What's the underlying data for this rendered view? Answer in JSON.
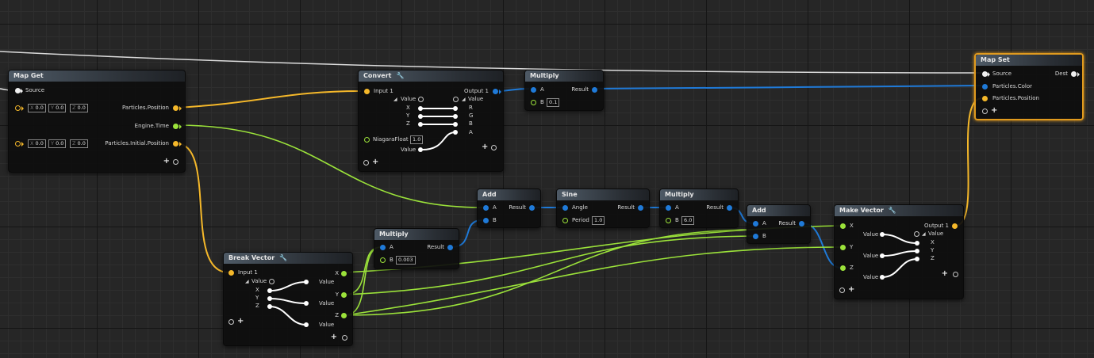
{
  "colors": {
    "position": "#f5b82a",
    "float": "#9be23a",
    "color": "#1f7ad8",
    "exec": "#f0f0f0",
    "selected": "#e09a1e"
  },
  "map_get": {
    "title": "Map Get",
    "source": "Source",
    "pos_out": "Particles.Position",
    "time_out": "Engine.Time",
    "init_out": "Particles.Initial.Position",
    "x_label": "X",
    "y_label": "Y",
    "z_label": "Z",
    "vec1": [
      "0.0",
      "0.0",
      "0.0"
    ],
    "vec2": [
      "0.0",
      "0.0",
      "0.0"
    ]
  },
  "convert": {
    "title": "Convert",
    "input": "Input 1",
    "output": "Output 1",
    "value_l": "Value",
    "value_r": "Value",
    "x": "X",
    "y": "Y",
    "z": "Z",
    "r": "R",
    "g": "G",
    "b": "B",
    "a": "A",
    "nf_label": "NiagaraFloat",
    "nf_value": "1.0",
    "value_bottom": "Value"
  },
  "multiply1": {
    "title": "Multiply",
    "a": "A",
    "b": "B",
    "result": "Result",
    "b_value": "0.1"
  },
  "map_set": {
    "title": "Map Set",
    "source": "Source",
    "dest": "Dest",
    "color": "Particles.Color",
    "position": "Particles.Position"
  },
  "add1": {
    "title": "Add",
    "a": "A",
    "b": "B",
    "result": "Result"
  },
  "sine": {
    "title": "Sine",
    "angle": "Angle",
    "period": "Period",
    "period_value": "1.0",
    "result": "Result"
  },
  "multiply2": {
    "title": "Multiply",
    "a": "A",
    "b": "B",
    "result": "Result",
    "b_value": "6.0"
  },
  "add2": {
    "title": "Add",
    "a": "A",
    "b": "B",
    "result": "Result"
  },
  "multiply3": {
    "title": "Multiply",
    "a": "A",
    "b": "B",
    "result": "Result",
    "b_value": "0.003"
  },
  "break_vector": {
    "title": "Break Vector",
    "input": "Input 1",
    "value": "Value",
    "x": "X",
    "y": "Y",
    "z": "Z",
    "v1": "Value",
    "v2": "Value",
    "v3": "Value",
    "out_x": "X",
    "out_y": "Y",
    "out_z": "Z"
  },
  "make_vector": {
    "title": "Make Vector",
    "x": "X",
    "y": "Y",
    "z": "Z",
    "output": "Output 1",
    "value": "Value",
    "v1": "Value",
    "v2": "Value",
    "v3": "Value",
    "ox": "X",
    "oy": "Y",
    "oz": "Z"
  }
}
